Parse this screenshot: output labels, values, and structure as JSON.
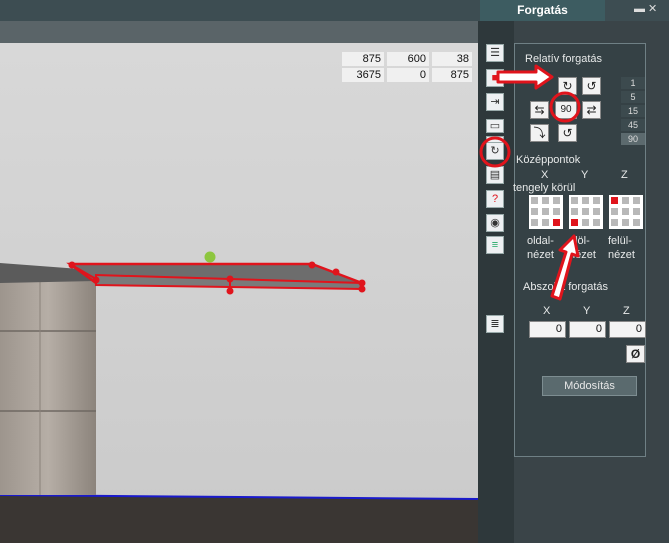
{
  "panel": {
    "title": "Forgatás"
  },
  "window_controls": "▬ ✕",
  "coords": {
    "row1": [
      "875",
      "600",
      "38"
    ],
    "row2": [
      "3675",
      "0",
      "875"
    ]
  },
  "relative": {
    "title": "Relatív forgatás",
    "angle_value": "90",
    "steps": [
      "1",
      "5",
      "15",
      "45",
      "90"
    ]
  },
  "centers": {
    "title": "Középpontok",
    "axis_x": "X",
    "axis_y": "Y",
    "axis_z": "Z",
    "around_label": "tengely körül",
    "view_labels": [
      "oldal-\nnézet",
      "elöl-\nnézet",
      "felül-\nnézet"
    ]
  },
  "absolute": {
    "title": "Abszolút forgatás",
    "axis_x": "X",
    "axis_y": "Y",
    "axis_z": "Z",
    "values": [
      "0",
      "0",
      "0"
    ],
    "reset_symbol": "Ø",
    "modify_button": "Módosítás"
  },
  "colors": {
    "highlight": "#e0141c",
    "panel_bg": "#354145",
    "accent_line": "#1a1acc"
  },
  "icons": [
    "list-icon",
    "rotate-object-icon",
    "move-in-icon",
    "resize-vertical-icon",
    "rotate-icon",
    "page-icon",
    "help-measure-icon",
    "visibility-eye-icon",
    "color-layers-icon",
    "lines-icon"
  ]
}
